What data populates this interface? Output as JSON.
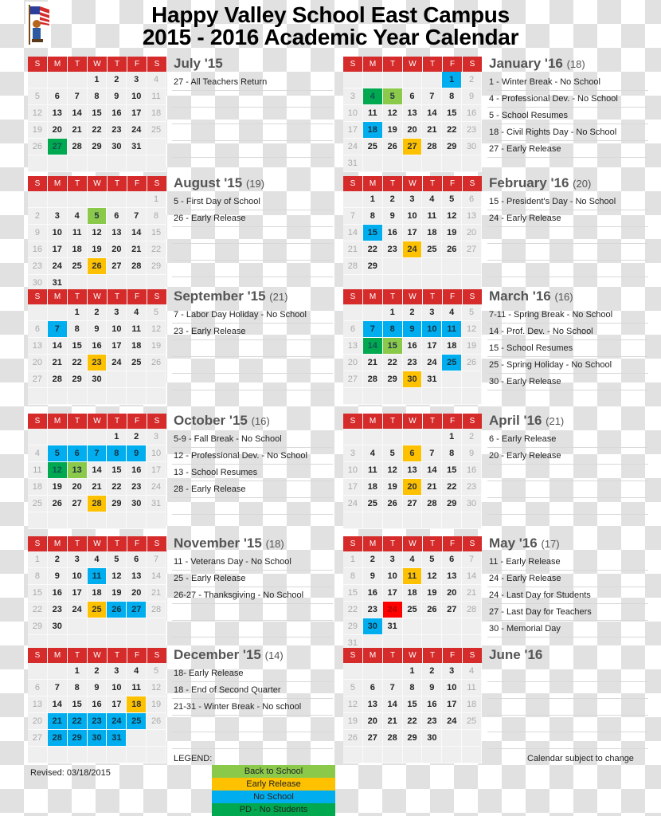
{
  "header": {
    "title_line1": "Happy Valley School East Campus",
    "title_line2": "2015 - 2016 Academic Year Calendar",
    "logo_icon": "flag-mascot-icon"
  },
  "weekdays": [
    "S",
    "M",
    "T",
    "W",
    "T",
    "F",
    "S"
  ],
  "colors": {
    "header_red": "#d52b2b",
    "back_to_school": "#8bc94b",
    "early_release": "#fdc100",
    "no_school": "#00aeef",
    "pd_no_students": "#00a94f",
    "last_day": "#ff0000"
  },
  "months": [
    {
      "name": "July '15",
      "count": "",
      "start": 3,
      "days": 31,
      "highlights": {
        "27": "green"
      },
      "events": [
        "27 - All Teachers Return"
      ]
    },
    {
      "name": "August '15",
      "count": "(19)",
      "start": 6,
      "days": 31,
      "highlights": {
        "5": "lime",
        "26": "yellow"
      },
      "events": [
        "5 - First Day of School",
        "26 - Early Release"
      ]
    },
    {
      "name": "September '15",
      "count": "(21)",
      "start": 2,
      "days": 30,
      "highlights": {
        "7": "blue",
        "23": "yellow"
      },
      "events": [
        "7 - Labor Day Holiday - No School",
        "23 - Early Release"
      ]
    },
    {
      "name": "October '15",
      "count": "(16)",
      "start": 4,
      "days": 31,
      "highlights": {
        "5": "blue",
        "6": "blue",
        "7": "blue",
        "8": "blue",
        "9": "blue",
        "12": "green",
        "13": "lime",
        "28": "yellow"
      },
      "events": [
        "5-9 - Fall Break - No School",
        "12 - Professional Dev. -  No School",
        "13 - School Resumes",
        "28 - Early Release"
      ]
    },
    {
      "name": "November '15",
      "count": "(18)",
      "start": 0,
      "days": 30,
      "highlights": {
        "11": "blue",
        "25": "yellow",
        "26": "blue",
        "27": "blue"
      },
      "events": [
        "11 - Veterans Day - No School",
        "25 - Early Release",
        "26-27 - Thanksgiving - No School"
      ]
    },
    {
      "name": "December '15",
      "count": "(14)",
      "start": 2,
      "days": 31,
      "highlights": {
        "18": "yellow",
        "21": "blue",
        "22": "blue",
        "23": "blue",
        "24": "blue",
        "25": "blue",
        "28": "blue",
        "29": "blue",
        "30": "blue",
        "31": "blue"
      },
      "events": [
        "18- Early Release",
        "18 - End of Second Quarter",
        "21-31 - Winter Break - No school"
      ]
    },
    {
      "name": "January '16",
      "count": "(18)",
      "start": 5,
      "days": 31,
      "highlights": {
        "1": "blue",
        "4": "green",
        "5": "lime",
        "18": "blue",
        "27": "yellow"
      },
      "events": [
        "1 -  Winter Break - No School",
        "4 - Professional Dev. - No School",
        "5 - School Resumes",
        "18 - Civil Rights Day - No School",
        "27 - Early Release"
      ]
    },
    {
      "name": "February '16",
      "count": "(20)",
      "start": 1,
      "days": 29,
      "highlights": {
        "15": "blue",
        "24": "yellow"
      },
      "events": [
        "15 - President's Day - No School",
        "24 - Early Release"
      ]
    },
    {
      "name": "March '16",
      "count": "(16)",
      "start": 2,
      "days": 31,
      "highlights": {
        "7": "blue",
        "8": "blue",
        "9": "blue",
        "10": "blue",
        "11": "blue",
        "14": "green",
        "15": "lime",
        "25": "blue",
        "30": "yellow"
      },
      "events": [
        "7-11 - Spring Break - No School",
        "14 - Prof. Dev. - No School",
        "15 - School Resumes",
        "25 - Spring Holiday - No School",
        "30 - Early Release"
      ]
    },
    {
      "name": "April '16",
      "count": "(21)",
      "start": 5,
      "days": 30,
      "highlights": {
        "6": "yellow",
        "20": "yellow"
      },
      "events": [
        "6 - Early Release",
        "20 - Early Release"
      ]
    },
    {
      "name": "May '16",
      "count": "(17)",
      "start": 0,
      "days": 31,
      "extra": "31",
      "highlights": {
        "11": "yellow",
        "24": "red",
        "30": "blue"
      },
      "events": [
        "11 - Early Release",
        "24 - Early Release",
        "24 - Last Day for Students",
        "27 - Last Day for Teachers",
        "30 - Memorial Day"
      ]
    },
    {
      "name": "June '16",
      "count": "",
      "start": 3,
      "days": 30,
      "highlights": {},
      "events": []
    }
  ],
  "footer": {
    "legend_label": "LEGEND:",
    "subject_to_change": "Calendar subject to change",
    "revised": "Revised:  03/18/2015",
    "legend": [
      {
        "label": "Back to School",
        "color": "#8bc94b"
      },
      {
        "label": "Early Release",
        "color": "#fdc100"
      },
      {
        "label": "No School",
        "color": "#00aeef"
      },
      {
        "label": "PD - No Students",
        "color": "#00a94f"
      }
    ]
  }
}
